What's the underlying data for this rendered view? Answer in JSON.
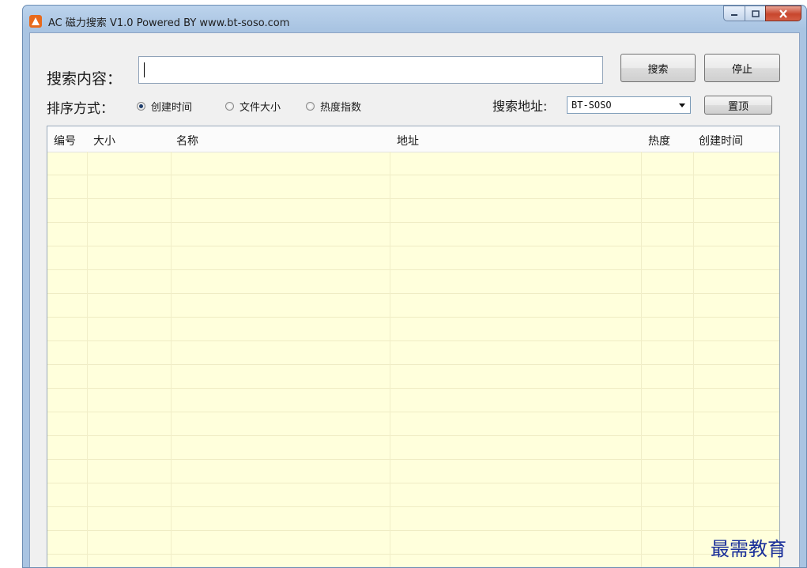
{
  "window": {
    "title": "AC 磁力搜索 V1.0 Powered BY www.bt-soso.com",
    "icon": "app-logo-icon",
    "controls": [
      "minimize-icon",
      "maximize-icon",
      "close-icon"
    ]
  },
  "search": {
    "label": "搜索内容：",
    "value": "",
    "search_button": "搜索",
    "stop_button": "停止"
  },
  "sort": {
    "label": "排序方式：",
    "options": [
      {
        "label": "创建时间",
        "checked": true
      },
      {
        "label": "文件大小",
        "checked": false
      },
      {
        "label": "热度指数",
        "checked": false
      }
    ]
  },
  "address": {
    "label": "搜索地址:",
    "selected": "BT-SOSO",
    "pin_button": "置顶"
  },
  "table": {
    "columns": [
      "编号",
      "大小",
      "名称",
      "地址",
      "热度",
      "创建时间"
    ],
    "rows": []
  },
  "watermark": "最需教育",
  "colors": {
    "grid_background": "#ffffdc",
    "watermark": "#1a2f9a",
    "title_bar": "#a9c4e2",
    "close_button": "#c8462d"
  }
}
